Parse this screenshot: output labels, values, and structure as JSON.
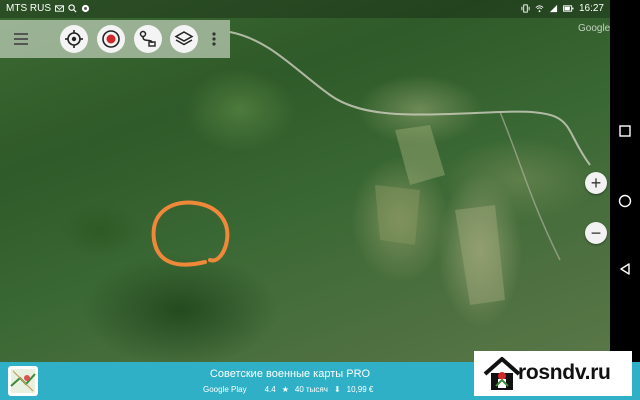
{
  "status_bar": {
    "carrier": "MTS RUS",
    "time": "16:27",
    "icons": [
      "mail-icon",
      "search-icon",
      "settings-icon",
      "vibrate-icon",
      "wifi-icon",
      "signal-icon",
      "battery-icon"
    ]
  },
  "toolbar": {
    "icons": [
      "menu-icon",
      "locate-icon",
      "record-icon",
      "route-icon",
      "layers-icon",
      "more-icon"
    ]
  },
  "map": {
    "watermark": "Google",
    "annotation_color": "#f0883a",
    "zoom_in_label": "+",
    "zoom_out_label": "−"
  },
  "nav_bar": {
    "icons": [
      "recent-apps-icon",
      "home-icon",
      "back-icon"
    ]
  },
  "banner": {
    "title": "Советские военные карты PRO",
    "store": "Google Play",
    "rating": "4.4",
    "downloads": "40 тысяч",
    "price": "10,99 €",
    "color": "#2fb0c6"
  },
  "site_badge": {
    "text": "rosndv.ru",
    "accent": "#d0272b"
  }
}
